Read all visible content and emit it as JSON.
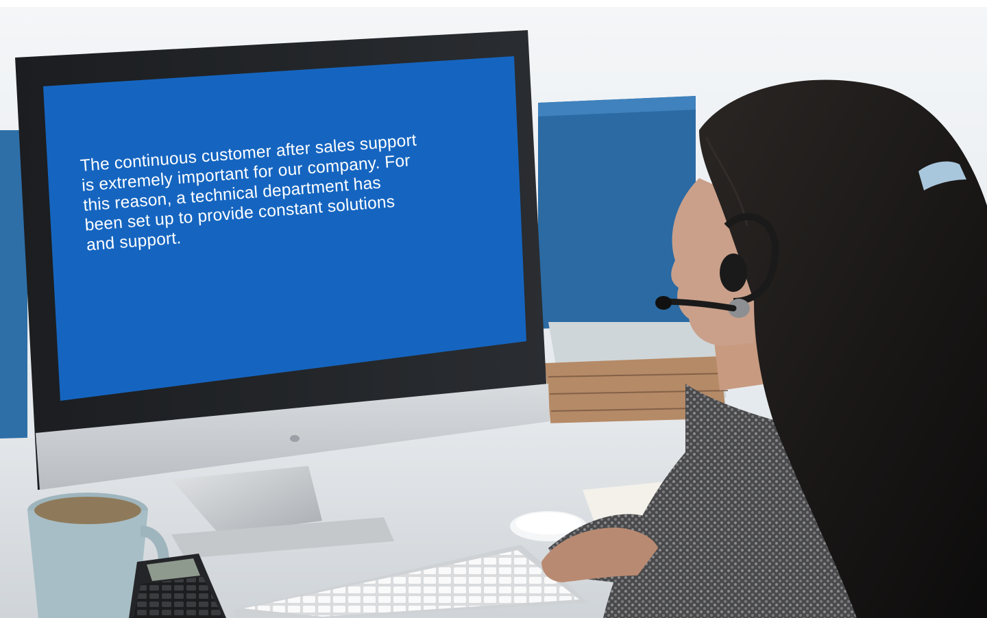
{
  "screen": {
    "lines": [
      "The continuous customer after sales support",
      "is extremely important for our company. For",
      "this reason, a technical department has",
      "been set up to provide constant solutions",
      "and support."
    ]
  },
  "colors": {
    "screen_blue": "#1565c0",
    "background": "#eef2f5",
    "hair": "#1a1a1a"
  }
}
